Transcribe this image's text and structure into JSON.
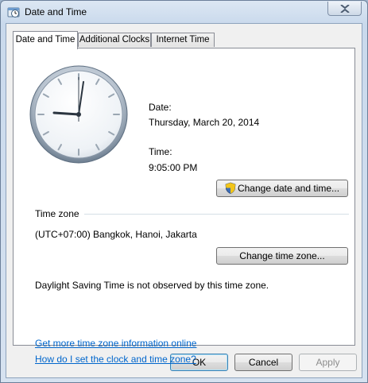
{
  "window": {
    "title": "Date and Time"
  },
  "tabs": [
    {
      "label": "Date and Time"
    },
    {
      "label": "Additional Clocks"
    },
    {
      "label": "Internet Time"
    }
  ],
  "date": {
    "label": "Date:",
    "value": "Thursday, March 20, 2014"
  },
  "time": {
    "label": "Time:",
    "value": "9:05:00 PM"
  },
  "buttons": {
    "change_datetime": "Change date and time...",
    "change_timezone": "Change time zone...",
    "ok": "OK",
    "cancel": "Cancel",
    "apply": "Apply"
  },
  "timezone": {
    "section_label": "Time zone",
    "value": "(UTC+07:00) Bangkok, Hanoi, Jakarta",
    "dst_note": "Daylight Saving Time is not observed by this time zone."
  },
  "links": {
    "more_info": "Get more time zone information online",
    "how_to": "How do I set the clock and time zone?"
  },
  "icons": {
    "title": "clock-window-icon",
    "close": "close-icon",
    "uac_shield": "uac-shield-icon"
  }
}
